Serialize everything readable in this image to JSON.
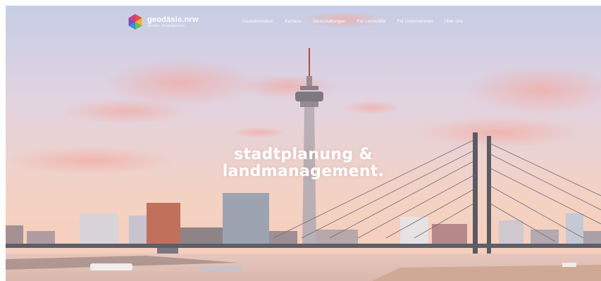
{
  "brand": {
    "name": "geodäsie.nrw",
    "tagline": "wissen. verantworten."
  },
  "nav": {
    "items": [
      "Geoinformation",
      "Karriere",
      "Veranstaltungen",
      "Für Lehrkräfte",
      "Für Unternehmen",
      "Über uns"
    ]
  },
  "hero": {
    "line1": "stadtplanung &",
    "line2": "landmanagement."
  },
  "colors": {
    "sky_top": "#c9cfe6",
    "sky_bottom": "#f3cdbd",
    "water": "#e9cbc1",
    "logo": [
      "#e94f3d",
      "#f6b23a",
      "#6cbf4a",
      "#3a8fd6",
      "#7b4fb4"
    ]
  }
}
